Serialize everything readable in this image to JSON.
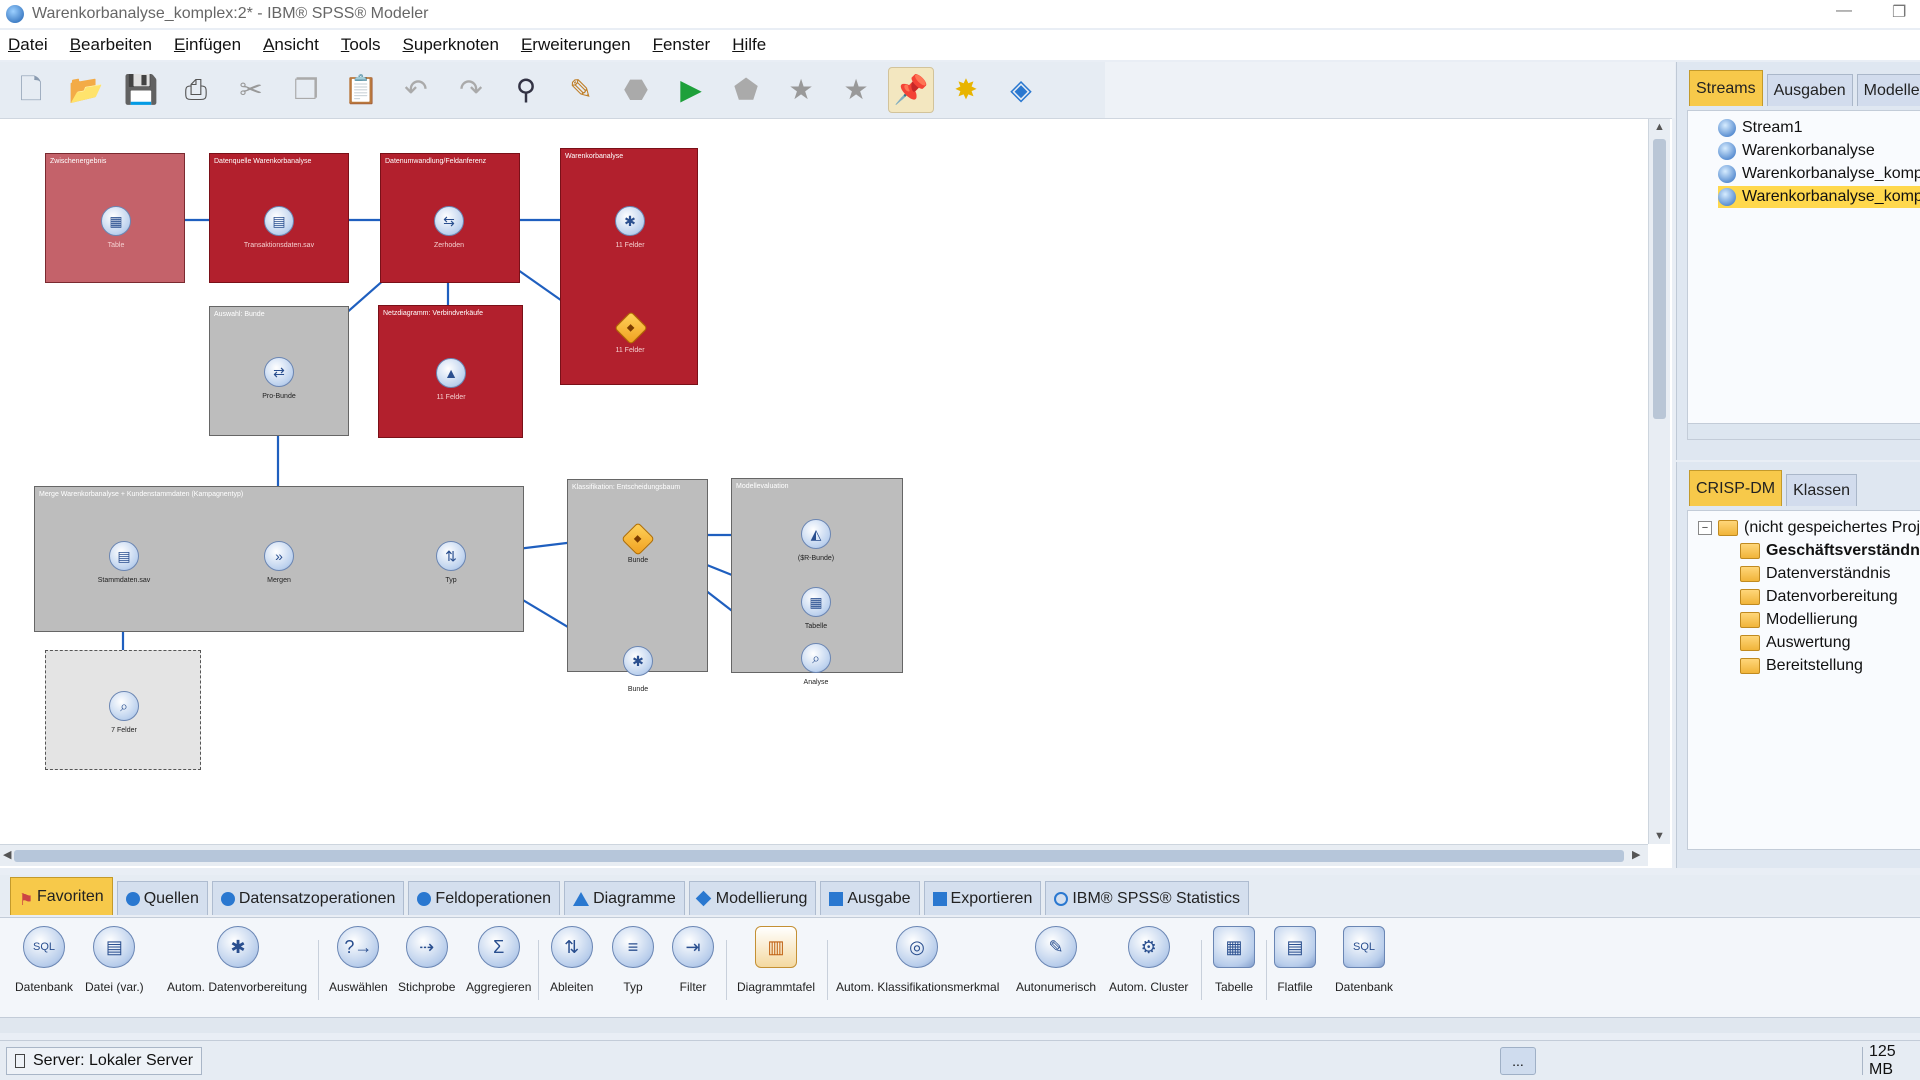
{
  "window": {
    "title": "Warenkorbanalyse_komplex:2* - IBM® SPSS® Modeler"
  },
  "menu": [
    "Datei",
    "Bearbeiten",
    "Einfügen",
    "Ansicht",
    "Tools",
    "Superknoten",
    "Erweiterungen",
    "Fenster",
    "Hilfe"
  ],
  "toolbar_icons": [
    "new-icon",
    "open-icon",
    "save-icon",
    "print-icon",
    "cut-icon",
    "copy-icon",
    "paste-icon",
    "undo-icon",
    "redo-icon",
    "find-icon",
    "edit-icon",
    "stop-icon",
    "run-icon",
    "run-selection-icon",
    "insert-supernode-icon",
    "zoom-supernode-icon",
    "annotation-icon",
    "comment-icon",
    "model-gem-icon"
  ],
  "canvas": {
    "supernodes": [
      {
        "id": "zwischenergebnis",
        "title": "Zwischenergebnis",
        "color": "pink",
        "nodes": [
          {
            "glyph": "▦",
            "label": "Table"
          }
        ]
      },
      {
        "id": "datenquelle",
        "title": "Datenquelle Warenkorbanalyse",
        "color": "red",
        "nodes": [
          {
            "glyph": "▤",
            "label": "Transaktionsdaten.sav"
          }
        ]
      },
      {
        "id": "datenumwandlung",
        "title": "Datenumwandlung/Feldanferenz",
        "color": "red",
        "nodes": [
          {
            "glyph": "⇆",
            "label": "Zerhoden"
          }
        ]
      },
      {
        "id": "warenkorb",
        "title": "Warenkorbanalyse",
        "color": "red",
        "nodes": [
          {
            "glyph": "✱",
            "label": "11 Felder"
          },
          {
            "glyph": "◆",
            "label": "11 Felder"
          }
        ]
      },
      {
        "id": "auswahl",
        "title": "Auswahl: Bunde",
        "color": "gray",
        "nodes": [
          {
            "glyph": "⇄",
            "label": "Pro-Bunde"
          }
        ]
      },
      {
        "id": "netzdiagramm",
        "title": "Netzdiagramm: Verbindverkäufe",
        "color": "red",
        "nodes": [
          {
            "glyph": "▲",
            "label": "11 Felder"
          }
        ]
      },
      {
        "id": "merge-sn",
        "title": "Merge Warenkorbanalyse + Kundenstammdaten (Kampagnentyp)",
        "color": "gray",
        "nodes": [
          {
            "glyph": "▤",
            "label": "Stammdaten.sav"
          },
          {
            "glyph": "»",
            "label": "Mergen"
          },
          {
            "glyph": "⇅",
            "label": "Typ"
          }
        ]
      },
      {
        "id": "klassifikation",
        "title": "Klassifikation: Entscheidungsbaum",
        "color": "gray",
        "nodes": [
          {
            "glyph": "◆",
            "label": "Bunde"
          },
          {
            "glyph": "✱",
            "label": "Bunde"
          }
        ]
      },
      {
        "id": "modellevaluation",
        "title": "Modellevaluation",
        "color": "gray",
        "nodes": [
          {
            "glyph": "◭",
            "label": "($R-Bunde)"
          },
          {
            "glyph": "▦",
            "label": "Tabelle"
          },
          {
            "glyph": "⌕",
            "label": "Analyse"
          }
        ]
      },
      {
        "id": "felder7",
        "title": "",
        "color": "dashed",
        "nodes": [
          {
            "glyph": "⌕",
            "label": "7 Felder"
          }
        ]
      }
    ]
  },
  "right_top": {
    "tabs": [
      "Streams",
      "Ausgaben",
      "Modelle"
    ],
    "active_tab": "Streams",
    "items": [
      "Stream1",
      "Warenkorbanalyse",
      "Warenkorbanalyse_kompl",
      "Warenkorbanalyse_kompl"
    ],
    "selected_index": 3
  },
  "right_bottom": {
    "tabs": [
      "CRISP-DM",
      "Klassen"
    ],
    "active_tab": "CRISP-DM",
    "root": "(nicht gespeichertes Proje",
    "expander": "−",
    "folders": [
      "Geschäftsverständnis",
      "Datenverständnis",
      "Datenvorbereitung",
      "Modellierung",
      "Auswertung",
      "Bereitstellung"
    ]
  },
  "palette": {
    "tabs": [
      "Favoriten",
      "Quellen",
      "Datensatzoperationen",
      "Feldoperationen",
      "Diagramme",
      "Modellierung",
      "Ausgabe",
      "Exportieren",
      "IBM® SPSS® Statistics"
    ],
    "active_tab": "Favoriten",
    "nodes": [
      {
        "label": "Datenbank",
        "glyph": "SQL",
        "icon": "database-icon"
      },
      {
        "label": "Datei (var.)",
        "glyph": "▤",
        "icon": "var-file-icon"
      },
      {
        "label": "Autom. Datenvorbereitung",
        "glyph": "✱",
        "icon": "auto-data-prep-icon"
      },
      {
        "label": "Auswählen",
        "glyph": "?→",
        "icon": "select-icon"
      },
      {
        "label": "Stichprobe",
        "glyph": "⇢",
        "icon": "sample-icon"
      },
      {
        "label": "Aggregieren",
        "glyph": "Σ",
        "icon": "aggregate-icon"
      },
      {
        "label": "Ableiten",
        "glyph": "⇅",
        "icon": "derive-icon"
      },
      {
        "label": "Typ",
        "glyph": "≡",
        "icon": "type-icon"
      },
      {
        "label": "Filter",
        "glyph": "⇥",
        "icon": "filter-icon"
      },
      {
        "label": "Diagrammtafel",
        "glyph": "▥",
        "icon": "graphboard-icon"
      },
      {
        "label": "Autom. Klassifikationsmerkmal",
        "glyph": "◎",
        "icon": "auto-classifier-icon"
      },
      {
        "label": "Autonumerisch",
        "glyph": "✎",
        "icon": "auto-numeric-icon"
      },
      {
        "label": "Autom. Cluster",
        "glyph": "⚙",
        "icon": "auto-cluster-icon"
      },
      {
        "label": "Tabelle",
        "glyph": "▦",
        "icon": "table-icon"
      },
      {
        "label": "Flatfile",
        "glyph": "▤",
        "icon": "flatfile-icon"
      },
      {
        "label": "Datenbank",
        "glyph": "SQL",
        "icon": "database-export-icon"
      }
    ]
  },
  "status": {
    "server": "Server: Lokaler Server",
    "memory": "125 MB",
    "more": "..."
  },
  "colors": {
    "accent_tab": "#f7c94a",
    "supernode_red": "#b2202d",
    "link": "#1f5fbf"
  }
}
